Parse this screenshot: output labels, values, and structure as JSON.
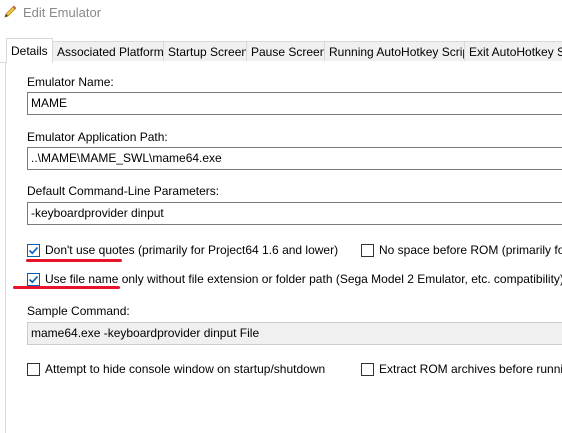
{
  "window": {
    "title": "Edit Emulator",
    "icon": "pencil-icon"
  },
  "tabs": [
    {
      "label": "Details",
      "active": true
    },
    {
      "label": "Associated Platforms"
    },
    {
      "label": "Startup Screen"
    },
    {
      "label": "Pause Screen"
    },
    {
      "label": "Running AutoHotkey Script"
    },
    {
      "label": "Exit AutoHotkey Sc"
    }
  ],
  "details": {
    "emulator_name_label": "Emulator Name:",
    "emulator_name_value": "MAME",
    "app_path_label": "Emulator Application Path:",
    "app_path_value": "..\\MAME\\MAME_SWL\\mame64.exe",
    "cmd_params_label": "Default Command-Line Parameters:",
    "cmd_params_value": "-keyboardprovider dinput",
    "dont_use_quotes": {
      "label": "Don't use quotes (primarily for Project64 1.6 and lower)",
      "checked": true
    },
    "no_space_before_rom": {
      "label": "No space before ROM (primarily for nu",
      "checked": false
    },
    "use_file_name_only": {
      "label": "Use file name only without file extension or folder path (Sega Model 2 Emulator, etc. compatibility)",
      "checked": true
    },
    "sample_command_label": "Sample Command:",
    "sample_command_value": "mame64.exe -keyboardprovider dinput File",
    "hide_console": {
      "label": "Attempt to hide console window on startup/shutdown",
      "checked": false
    },
    "extract_rom": {
      "label": "Extract ROM archives before running",
      "checked": false
    }
  },
  "colors": {
    "accent": "#005fb8",
    "annotation": "#e8132b",
    "border": "#7a7a7a"
  }
}
